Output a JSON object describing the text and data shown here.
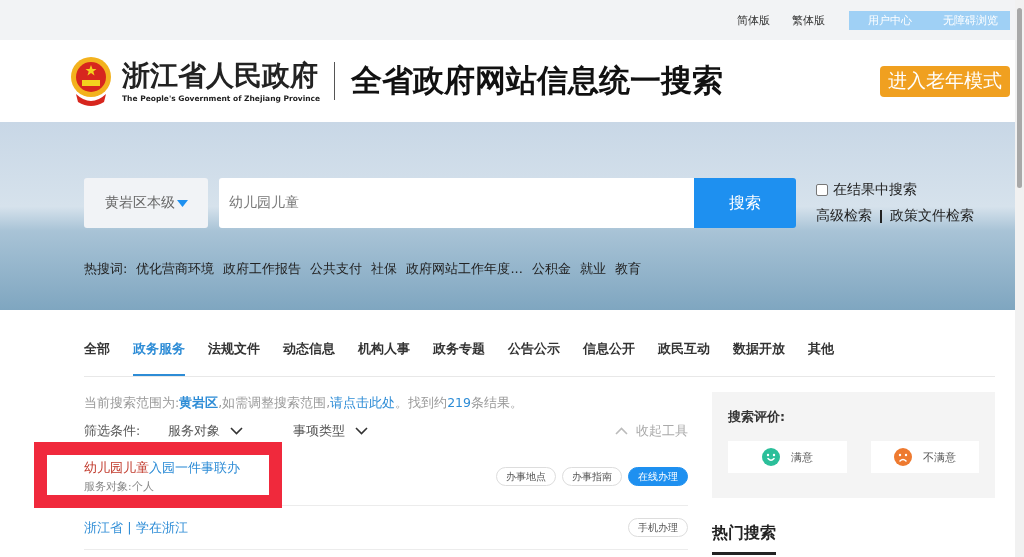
{
  "top_bar": {
    "links": [
      "简体版",
      "繁体版"
    ],
    "buttons": [
      "用户中心",
      "无障碍浏览"
    ]
  },
  "header": {
    "org_name": "浙江省人民政府",
    "org_name_en": "The People's Government of Zhejiang Province",
    "title": "全省政府网站信息统一搜索",
    "elder_mode_button": "进入老年模式"
  },
  "search": {
    "scope": "黄岩区本级",
    "value": "幼儿园儿童",
    "button": "搜索",
    "within_results": {
      "label": "在结果中搜索",
      "checked": false
    },
    "links": [
      "高级检索",
      "政策文件检索"
    ],
    "hot_label": "热搜词:",
    "hot_words": [
      "优化营商环境",
      "政府工作报告",
      "公共支付",
      "社保",
      "政府网站工作年度...",
      "公积金",
      "就业",
      "教育"
    ]
  },
  "tabs": [
    {
      "label": "全部",
      "selected": false
    },
    {
      "label": "政务服务",
      "selected": true
    },
    {
      "label": "法规文件",
      "selected": false
    },
    {
      "label": "动态信息",
      "selected": false
    },
    {
      "label": "机构人事",
      "selected": false
    },
    {
      "label": "政务专题",
      "selected": false
    },
    {
      "label": "公告公示",
      "selected": false
    },
    {
      "label": "信息公开",
      "selected": false
    },
    {
      "label": "政民互动",
      "selected": false
    },
    {
      "label": "数据开放",
      "selected": false
    },
    {
      "label": "其他",
      "selected": false
    }
  ],
  "scope_info": [
    {
      "kind": "plain",
      "text": "当前搜索范围为:"
    },
    {
      "kind": "highlight",
      "text": "黄岩区"
    },
    {
      "kind": "plain",
      "text": ",如需调整搜索范围,"
    },
    {
      "kind": "link",
      "text": "请点击此处"
    },
    {
      "kind": "plain",
      "text": "。找到约"
    },
    {
      "kind": "count",
      "text": "219"
    },
    {
      "kind": "plain",
      "text": "条结果。"
    }
  ],
  "filters": {
    "label": "筛选条件:",
    "dropdowns": [
      "服务对象",
      "事项类型"
    ],
    "collapse": "收起工具"
  },
  "results": [
    {
      "annotated": true,
      "title": [
        {
          "kind": "match",
          "text": "幼儿园儿童"
        },
        {
          "kind": "plain",
          "text": "入园一件事联办"
        }
      ],
      "subtitle": "服务对象:个人",
      "actions": [
        {
          "label": "办事地点",
          "kind": "outline"
        },
        {
          "label": "办事指南",
          "kind": "outline"
        },
        {
          "label": "在线办理",
          "kind": "filled"
        }
      ]
    },
    {
      "annotated": false,
      "title": [
        {
          "kind": "plain",
          "text": "浙江省 | 学在浙江"
        }
      ],
      "actions": [
        {
          "label": "手机办理",
          "kind": "outline"
        }
      ]
    }
  ],
  "rating": {
    "title": "搜索评价:",
    "options": [
      {
        "label": "满意",
        "kind": "happy"
      },
      {
        "label": "不满意",
        "kind": "sad"
      }
    ]
  },
  "hot_searches": {
    "title": "热门搜索"
  }
}
